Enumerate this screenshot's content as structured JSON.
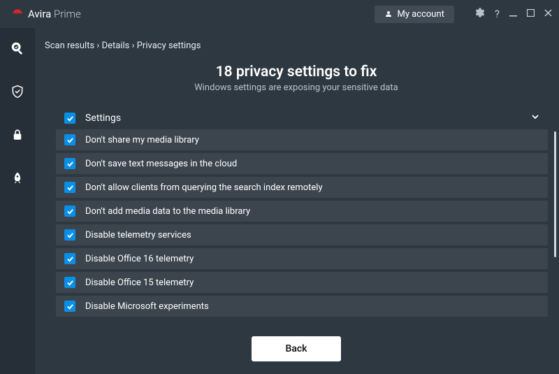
{
  "titlebar": {
    "brand": "Avira",
    "product": "Prime",
    "account_label": "My account"
  },
  "breadcrumb": {
    "item1": "Scan results",
    "item2": "Details",
    "item3": "Privacy settings"
  },
  "page": {
    "title": "18 privacy settings to fix",
    "subtitle": "Windows settings are exposing your sensitive data"
  },
  "list": {
    "header_label": "Settings",
    "rows": [
      "Don't share my media library",
      "Don't save text messages in the cloud",
      "Don't allow clients from querying the search index remotely",
      "Don't add media data to the media library",
      "Disable telemetry services",
      "Disable Office 16 telemetry",
      "Disable Office 15 telemetry",
      "Disable Microsoft experiments"
    ]
  },
  "footer": {
    "back_label": "Back"
  }
}
